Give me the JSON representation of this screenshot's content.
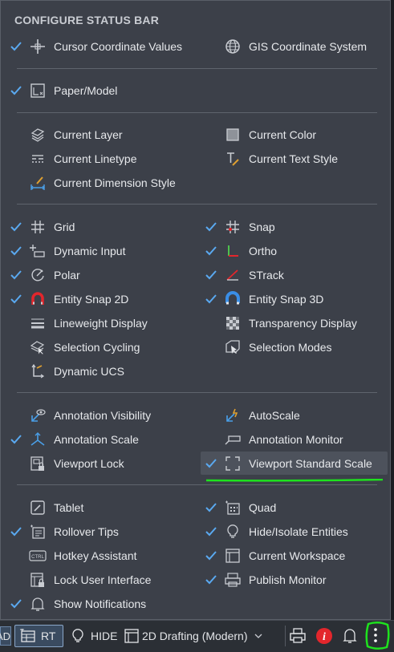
{
  "menu": {
    "title": "CONFIGURE STATUS BAR",
    "sections": [
      {
        "items": [
          {
            "label": "Cursor Coordinate Values",
            "checked": true,
            "icon": "crosshair-icon"
          },
          {
            "label": "GIS Coordinate System",
            "checked": false,
            "icon": "globe-icon"
          }
        ]
      },
      {
        "items": [
          {
            "label": "Paper/Model",
            "checked": true,
            "icon": "paper-model-icon"
          }
        ]
      },
      {
        "items": [
          {
            "label": "Current Layer",
            "checked": false,
            "icon": "layers-icon"
          },
          {
            "label": "Current Color",
            "checked": false,
            "icon": "color-square-icon"
          },
          {
            "label": "Current Linetype",
            "checked": false,
            "icon": "linetype-icon"
          },
          {
            "label": "Current Text Style",
            "checked": false,
            "icon": "text-style-icon"
          },
          {
            "label": "Current Dimension Style",
            "checked": false,
            "icon": "dimension-style-icon"
          }
        ]
      },
      {
        "items": [
          {
            "label": "Grid",
            "checked": true,
            "icon": "grid-icon"
          },
          {
            "label": "Snap",
            "checked": true,
            "icon": "snap-grid-icon"
          },
          {
            "label": "Dynamic Input",
            "checked": true,
            "icon": "dynamic-input-icon"
          },
          {
            "label": "Ortho",
            "checked": true,
            "icon": "ortho-icon"
          },
          {
            "label": "Polar",
            "checked": true,
            "icon": "polar-icon"
          },
          {
            "label": "STrack",
            "checked": true,
            "icon": "strack-icon"
          },
          {
            "label": "Entity Snap 2D",
            "checked": true,
            "icon": "magnet-icon"
          },
          {
            "label": "Entity Snap 3D",
            "checked": true,
            "icon": "magnet-3d-icon"
          },
          {
            "label": "Lineweight Display",
            "checked": false,
            "icon": "lineweight-icon"
          },
          {
            "label": "Transparency Display",
            "checked": false,
            "icon": "transparency-icon"
          },
          {
            "label": "Selection Cycling",
            "checked": false,
            "icon": "selection-cycling-icon"
          },
          {
            "label": "Selection Modes",
            "checked": false,
            "icon": "selection-modes-icon"
          },
          {
            "label": "Dynamic UCS",
            "checked": false,
            "icon": "dynamic-ucs-icon"
          }
        ]
      },
      {
        "items": [
          {
            "label": "Annotation Visibility",
            "checked": false,
            "icon": "annotation-visibility-icon"
          },
          {
            "label": "AutoScale",
            "checked": false,
            "icon": "autoscale-icon"
          },
          {
            "label": "Annotation Scale",
            "checked": true,
            "icon": "annotation-scale-icon"
          },
          {
            "label": "Annotation Monitor",
            "checked": false,
            "icon": "annotation-monitor-icon"
          },
          {
            "label": "Viewport Lock",
            "checked": false,
            "icon": "viewport-lock-icon"
          },
          {
            "label": "Viewport Standard Scale",
            "checked": true,
            "icon": "viewport-scale-icon",
            "highlighted": true
          }
        ]
      },
      {
        "items": [
          {
            "label": "Tablet",
            "checked": false,
            "icon": "tablet-icon"
          },
          {
            "label": "Quad",
            "checked": true,
            "icon": "quad-icon"
          },
          {
            "label": "Rollover Tips",
            "checked": true,
            "icon": "rollover-tips-icon"
          },
          {
            "label": "Hide/Isolate Entities",
            "checked": true,
            "icon": "lightbulb-icon"
          },
          {
            "label": "Hotkey Assistant",
            "checked": false,
            "icon": "ctrl-key-icon"
          },
          {
            "label": "Current Workspace",
            "checked": true,
            "icon": "workspace-icon"
          },
          {
            "label": "Lock User Interface",
            "checked": false,
            "icon": "lock-ui-icon"
          },
          {
            "label": "Publish Monitor",
            "checked": true,
            "icon": "publish-monitor-icon"
          },
          {
            "label": "Show Notifications",
            "checked": true,
            "icon": "bell-icon"
          }
        ]
      }
    ]
  },
  "statusbar": {
    "left_fragment": "AD",
    "rt_label": "RT",
    "hide_label": "HIDE",
    "workspace_label": "2D Drafting (Modern)",
    "icons": [
      "table-icon",
      "lightbulb-icon",
      "workspace-icon",
      "chevron-down-icon",
      "printer-icon",
      "info-badge-icon",
      "bell-icon",
      "more-vertical-icon"
    ]
  },
  "colors": {
    "menu_bg": "#3c4049",
    "check": "#5aa9f0",
    "accent_blue": "#4a9fe8",
    "highlight_bg": "#4d525c",
    "annotation_green": "#1ee21e",
    "info_red": "#e3262c"
  }
}
